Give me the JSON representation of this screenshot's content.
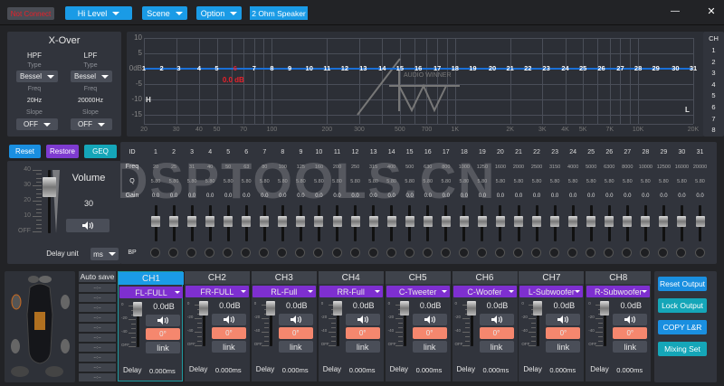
{
  "topbar": {
    "status": "Not Connect",
    "hi_level": "Hi Level",
    "scene": "Scene",
    "option": "Option",
    "speaker": "2 Ohm Speaker",
    "minimize": "—",
    "close": "✕"
  },
  "xover": {
    "title": "X-Over",
    "hpf": {
      "label": "HPF",
      "type_label": "Type",
      "type": "Bessel",
      "freq_label": "Freq",
      "freq": "20Hz",
      "slope_label": "Slope",
      "slope": "OFF"
    },
    "lpf": {
      "label": "LPF",
      "type_label": "Type",
      "type": "Bessel",
      "freq_label": "Freq",
      "freq": "20000Hz",
      "slope_label": "Slope",
      "slope": "OFF"
    }
  },
  "graph": {
    "y_ticks": [
      "10",
      "5",
      "0dB",
      "-5",
      "-10",
      "-15"
    ],
    "x_ticks": [
      "20",
      "30",
      "40",
      "50",
      "70",
      "100",
      "200",
      "300",
      "500",
      "700",
      "1K",
      "2K",
      "3K",
      "4K",
      "5K",
      "7K",
      "10K",
      "20K"
    ],
    "selected_gain": "0.0 dB",
    "h_marker": "H",
    "l_marker": "L",
    "watermark": "AUDIO WINNER",
    "ch_header": "CH",
    "channels": [
      "1",
      "2",
      "3",
      "4",
      "5",
      "6",
      "7",
      "8"
    ],
    "accent": "#1a6fd6"
  },
  "controls": {
    "reset": "Reset",
    "restore": "Restore",
    "geq": "GEQ"
  },
  "volume": {
    "title": "Volume",
    "value": "30",
    "scale": [
      "40",
      "30",
      "20",
      "10",
      "OFF"
    ],
    "delay_unit_label": "Delay unit",
    "delay_unit": "ms"
  },
  "eq": {
    "row_labels": {
      "id": "ID",
      "freq": "Freq",
      "q": "Q",
      "gain": "Gain",
      "bp": "BP"
    },
    "bands": [
      {
        "id": "1",
        "freq": "20",
        "q": "5.80",
        "gain": "0.0"
      },
      {
        "id": "2",
        "freq": "25",
        "q": "5.80",
        "gain": "0.0"
      },
      {
        "id": "3",
        "freq": "31",
        "q": "5.80",
        "gain": "0.0"
      },
      {
        "id": "4",
        "freq": "40",
        "q": "5.80",
        "gain": "0.0"
      },
      {
        "id": "5",
        "freq": "50",
        "q": "5.80",
        "gain": "0.0"
      },
      {
        "id": "6",
        "freq": "63",
        "q": "5.80",
        "gain": "0.0"
      },
      {
        "id": "7",
        "freq": "80",
        "q": "5.80",
        "gain": "0.0"
      },
      {
        "id": "8",
        "freq": "100",
        "q": "5.80",
        "gain": "0.0"
      },
      {
        "id": "9",
        "freq": "125",
        "q": "5.80",
        "gain": "0.0"
      },
      {
        "id": "10",
        "freq": "160",
        "q": "5.80",
        "gain": "0.0"
      },
      {
        "id": "11",
        "freq": "200",
        "q": "5.80",
        "gain": "0.0"
      },
      {
        "id": "12",
        "freq": "250",
        "q": "5.80",
        "gain": "0.0"
      },
      {
        "id": "13",
        "freq": "315",
        "q": "5.80",
        "gain": "0.0"
      },
      {
        "id": "14",
        "freq": "400",
        "q": "5.80",
        "gain": "0.0"
      },
      {
        "id": "15",
        "freq": "500",
        "q": "5.80",
        "gain": "0.0"
      },
      {
        "id": "16",
        "freq": "630",
        "q": "5.80",
        "gain": "0.0"
      },
      {
        "id": "17",
        "freq": "800",
        "q": "5.80",
        "gain": "0.0"
      },
      {
        "id": "18",
        "freq": "1000",
        "q": "5.80",
        "gain": "0.0"
      },
      {
        "id": "19",
        "freq": "1250",
        "q": "5.80",
        "gain": "0.0"
      },
      {
        "id": "20",
        "freq": "1600",
        "q": "5.80",
        "gain": "0.0"
      },
      {
        "id": "21",
        "freq": "2000",
        "q": "5.80",
        "gain": "0.0"
      },
      {
        "id": "22",
        "freq": "2500",
        "q": "5.80",
        "gain": "0.0"
      },
      {
        "id": "23",
        "freq": "3150",
        "q": "5.80",
        "gain": "0.0"
      },
      {
        "id": "24",
        "freq": "4000",
        "q": "5.80",
        "gain": "0.0"
      },
      {
        "id": "25",
        "freq": "5000",
        "q": "5.80",
        "gain": "0.0"
      },
      {
        "id": "26",
        "freq": "6300",
        "q": "5.80",
        "gain": "0.0"
      },
      {
        "id": "27",
        "freq": "8000",
        "q": "5.80",
        "gain": "0.0"
      },
      {
        "id": "28",
        "freq": "10000",
        "q": "5.80",
        "gain": "0.0"
      },
      {
        "id": "29",
        "freq": "12500",
        "q": "5.80",
        "gain": "0.0"
      },
      {
        "id": "30",
        "freq": "16000",
        "q": "5.80",
        "gain": "0.0"
      },
      {
        "id": "31",
        "freq": "20000",
        "q": "5.80",
        "gain": "0.0"
      }
    ],
    "selected_band": "6",
    "watermark": "DSPTOOLS.CN"
  },
  "autosave": {
    "title": "Auto save",
    "slots": [
      "--:--",
      "--:--",
      "--:--",
      "--:--",
      "--:--",
      "--:--",
      "--:--",
      "--:--",
      "--:--",
      "--:--"
    ]
  },
  "output": {
    "scale": [
      "0",
      "-20",
      "-40",
      "OFF"
    ],
    "delay_label": "Delay",
    "channels": [
      {
        "name": "CH1",
        "assign": "FL-FULL",
        "gain": "0.0dB",
        "phase": "0°",
        "link": "link",
        "delay": "0.000ms"
      },
      {
        "name": "CH2",
        "assign": "FR-FULL",
        "gain": "0.0dB",
        "phase": "0°",
        "link": "link",
        "delay": "0.000ms"
      },
      {
        "name": "CH3",
        "assign": "RL-Full",
        "gain": "0.0dB",
        "phase": "0°",
        "link": "link",
        "delay": "0.000ms"
      },
      {
        "name": "CH4",
        "assign": "RR-Full",
        "gain": "0.0dB",
        "phase": "0°",
        "link": "link",
        "delay": "0.000ms"
      },
      {
        "name": "CH5",
        "assign": "C-Tweeter",
        "gain": "0.0dB",
        "phase": "0°",
        "link": "link",
        "delay": "0.000ms"
      },
      {
        "name": "CH6",
        "assign": "C-Woofer",
        "gain": "0.0dB",
        "phase": "0°",
        "link": "link",
        "delay": "0.000ms"
      },
      {
        "name": "CH7",
        "assign": "L-Subwoofer",
        "gain": "0.0dB",
        "phase": "0°",
        "link": "link",
        "delay": "0.000ms"
      },
      {
        "name": "CH8",
        "assign": "R-Subwoofer",
        "gain": "0.0dB",
        "phase": "0°",
        "link": "link",
        "delay": "0.000ms"
      }
    ],
    "active": "CH1",
    "actions": {
      "reset": "Reset Output",
      "lock": "Lock Output",
      "copy": "COPY L&R",
      "mixing": "Mixing Set"
    }
  }
}
